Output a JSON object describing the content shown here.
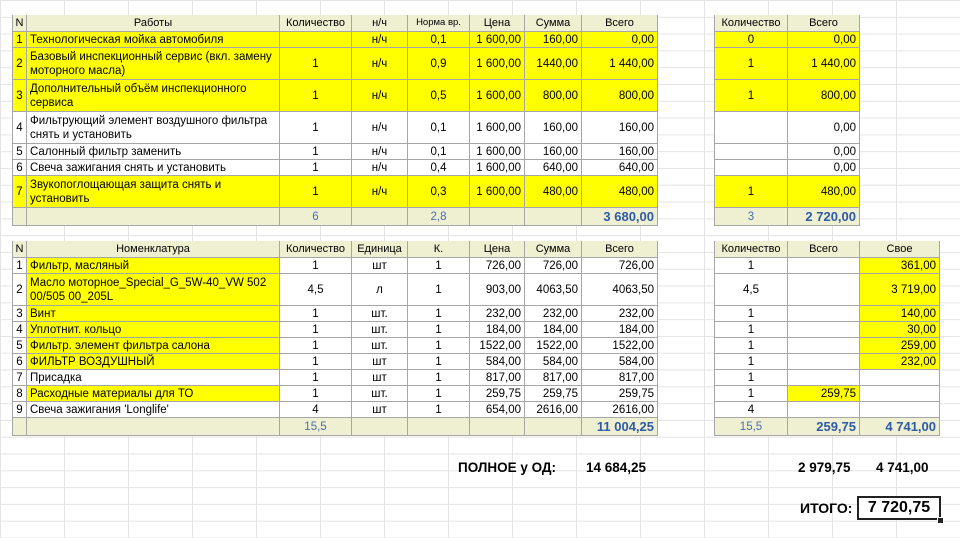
{
  "works": {
    "headers": [
      "N",
      "Работы",
      "Количество",
      "н/ч",
      "Норма вр.",
      "Цена",
      "Сумма",
      "Всего"
    ],
    "rows": [
      {
        "n": "1",
        "name": "Технологическая мойка автомобиля",
        "qty": "",
        "unit": "н/ч",
        "norm": "0,1",
        "price": "1 600,00",
        "sum": "160,00",
        "total": "0,00",
        "hl": "y"
      },
      {
        "n": "2",
        "name": "Базовый инспекционный сервис (вкл. замену моторного масла)",
        "qty": "1",
        "unit": "н/ч",
        "norm": "0,9",
        "price": "1 600,00",
        "sum": "1440,00",
        "total": "1 440,00",
        "hl": "y"
      },
      {
        "n": "3",
        "name": "Дополнительный объём инспекционного сервиса",
        "qty": "1",
        "unit": "н/ч",
        "norm": "0,5",
        "price": "1 600,00",
        "sum": "800,00",
        "total": "800,00",
        "hl": "y"
      },
      {
        "n": "4",
        "name": "Фильтрующий элемент воздушного фильтра снять и установить",
        "qty": "1",
        "unit": "н/ч",
        "norm": "0,1",
        "price": "1 600,00",
        "sum": "160,00",
        "total": "160,00",
        "hl": "w"
      },
      {
        "n": "5",
        "name": "Салонный фильтр заменить",
        "qty": "1",
        "unit": "н/ч",
        "norm": "0,1",
        "price": "1 600,00",
        "sum": "160,00",
        "total": "160,00",
        "hl": "w"
      },
      {
        "n": "6",
        "name": "Свеча зажигания снять и установить",
        "qty": "1",
        "unit": "н/ч",
        "norm": "0,4",
        "price": "1 600,00",
        "sum": "640,00",
        "total": "640,00",
        "hl": "w"
      },
      {
        "n": "7",
        "name": "Звукопоглощающая защита снять и установить",
        "qty": "1",
        "unit": "н/ч",
        "norm": "0,3",
        "price": "1 600,00",
        "sum": "480,00",
        "total": "480,00",
        "hl": "y"
      }
    ],
    "totals": {
      "qty": "6",
      "norm": "2,8",
      "total": "3 680,00"
    }
  },
  "works_right": {
    "headers": [
      "Количество",
      "Всего"
    ],
    "rows": [
      {
        "qty": "0",
        "total": "0,00",
        "hl": "y"
      },
      {
        "qty": "1",
        "total": "1 440,00",
        "hl": "y"
      },
      {
        "qty": "1",
        "total": "800,00",
        "hl": "y"
      },
      {
        "qty": "",
        "total": "0,00",
        "hl": "w"
      },
      {
        "qty": "",
        "total": "0,00",
        "hl": "w"
      },
      {
        "qty": "",
        "total": "0,00",
        "hl": "w"
      },
      {
        "qty": "1",
        "total": "480,00",
        "hl": "y"
      }
    ],
    "totals": {
      "qty": "3",
      "total": "2 720,00"
    }
  },
  "parts": {
    "headers": [
      "N",
      "Номенклатура",
      "Количество",
      "Единица",
      "К.",
      "Цена",
      "Сумма",
      "Всего"
    ],
    "rows": [
      {
        "n": "1",
        "name": "Фильтр, масляный",
        "qty": "1",
        "unit": "шт",
        "k": "1",
        "price": "726,00",
        "sum": "726,00",
        "total": "726,00",
        "hl": "y"
      },
      {
        "n": "2",
        "name": "Масло моторное_Special_G_5W-40_VW 502 00/505 00_205L",
        "qty": "4,5",
        "unit": "л",
        "k": "1",
        "price": "903,00",
        "sum": "4063,50",
        "total": "4063,50",
        "hl": "y"
      },
      {
        "n": "3",
        "name": "Винт",
        "qty": "1",
        "unit": "шт.",
        "k": "1",
        "price": "232,00",
        "sum": "232,00",
        "total": "232,00",
        "hl": "y"
      },
      {
        "n": "4",
        "name": "Уплотнит. кольцо",
        "qty": "1",
        "unit": "шт.",
        "k": "1",
        "price": "184,00",
        "sum": "184,00",
        "total": "184,00",
        "hl": "y"
      },
      {
        "n": "5",
        "name": "Фильтр. элемент фильтра салона",
        "qty": "1",
        "unit": "шт.",
        "k": "1",
        "price": "1522,00",
        "sum": "1522,00",
        "total": "1522,00",
        "hl": "y"
      },
      {
        "n": "6",
        "name": "ФИЛЬТР ВОЗДУШНЫЙ",
        "qty": "1",
        "unit": "шт",
        "k": "1",
        "price": "584,00",
        "sum": "584,00",
        "total": "584,00",
        "hl": "y"
      },
      {
        "n": "7",
        "name": "Присадка",
        "qty": "1",
        "unit": "шт",
        "k": "1",
        "price": "817,00",
        "sum": "817,00",
        "total": "817,00",
        "hl": "w"
      },
      {
        "n": "8",
        "name": "Расходные материалы для ТО",
        "qty": "1",
        "unit": "шт.",
        "k": "1",
        "price": "259,75",
        "sum": "259,75",
        "total": "259,75",
        "hl": "y"
      },
      {
        "n": "9",
        "name": "Свеча зажигания 'Longlife'",
        "qty": "4",
        "unit": "шт",
        "k": "1",
        "price": "654,00",
        "sum": "2616,00",
        "total": "2616,00",
        "hl": "w"
      }
    ],
    "totals": {
      "qty": "15,5",
      "total": "11 004,25"
    }
  },
  "parts_right": {
    "headers": [
      "Количество",
      "Всего",
      "Свое"
    ],
    "rows": [
      {
        "qty": "1",
        "total": "",
        "own": "361,00",
        "hl_total": "w",
        "hl_own": "y"
      },
      {
        "qty": "4,5",
        "total": "",
        "own": "3 719,00",
        "hl_total": "w",
        "hl_own": "y"
      },
      {
        "qty": "1",
        "total": "",
        "own": "140,00",
        "hl_total": "w",
        "hl_own": "y"
      },
      {
        "qty": "1",
        "total": "",
        "own": "30,00",
        "hl_total": "w",
        "hl_own": "y"
      },
      {
        "qty": "1",
        "total": "",
        "own": "259,00",
        "hl_total": "w",
        "hl_own": "y"
      },
      {
        "qty": "1",
        "total": "",
        "own": "232,00",
        "hl_total": "w",
        "hl_own": "y"
      },
      {
        "qty": "1",
        "total": "",
        "own": "",
        "hl_total": "w",
        "hl_own": "w"
      },
      {
        "qty": "1",
        "total": "259,75",
        "own": "",
        "hl_total": "y",
        "hl_own": "w"
      },
      {
        "qty": "4",
        "total": "",
        "own": "",
        "hl_total": "w",
        "hl_own": "w"
      }
    ],
    "totals": {
      "qty": "15,5",
      "total": "259,75",
      "own": "4 741,00"
    }
  },
  "summary": {
    "full_label": "ПОЛНОЕ у ОД:",
    "full_value": "14 684,25",
    "right_total": "2 979,75",
    "right_own": "4 741,00",
    "itogo_label": "ИТОГО:",
    "itogo_value": "7 720,75"
  },
  "colors": {
    "highlight": "#ffff00",
    "header_bg": "#efefd1",
    "totals_text": "#2e5aa8"
  }
}
